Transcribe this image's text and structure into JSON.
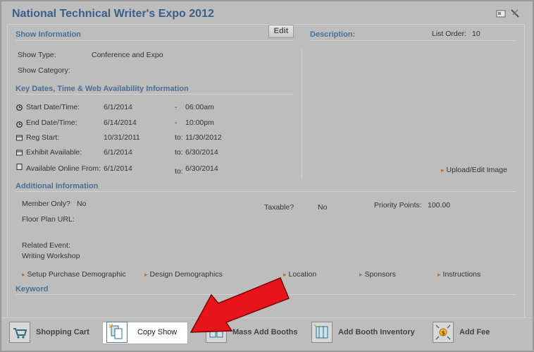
{
  "header": {
    "title": "National Technical Writer's Expo 2012"
  },
  "show_info": {
    "heading": "Show Information",
    "edit_label": "Edit",
    "show_type_label": "Show Type:",
    "show_type_value": "Conference and Expo",
    "show_category_label": "Show Category:"
  },
  "description": {
    "heading": "Description:",
    "list_order_label": "List Order:",
    "list_order_value": "10",
    "upload_link": "Upload/Edit Image"
  },
  "key_dates": {
    "heading": "Key Dates, Time & Web Availability Information",
    "rows": [
      {
        "label": "Start Date/Time:",
        "date": "6/1/2014",
        "sep": "-",
        "end": "06:00am"
      },
      {
        "label": "End Date/Time:",
        "date": "6/14/2014",
        "sep": "-",
        "end": "10:00pm"
      },
      {
        "label": "Reg Start:",
        "date": "10/31/2011",
        "sep": "to:",
        "end": "11/30/2012"
      },
      {
        "label": "Exhibit Available:",
        "date": "6/1/2014",
        "sep": "to:",
        "end": "6/30/2014"
      },
      {
        "label": "Available Online From:",
        "date": "6/1/2014",
        "sep": "to:",
        "end": "6/30/2014"
      }
    ]
  },
  "additional": {
    "heading": "Additional Information",
    "member_only_label": "Member Only?",
    "member_only_value": "No",
    "taxable_label": "Taxable?",
    "taxable_value": "No",
    "priority_label": "Priority Points:",
    "priority_value": "100.00",
    "floor_plan_label": "Floor Plan URL:",
    "related_event_label": "Related Event:",
    "related_event_value": "Writing Workshop",
    "links": [
      "Setup Purchase Demographic",
      "Design Demographics",
      "Location",
      "Sponsors",
      "Instructions"
    ]
  },
  "keyword": {
    "heading": "Keyword"
  },
  "footer": {
    "shopping_cart": "Shopping Cart",
    "copy_show": "Copy Show",
    "mass_add_booths": "Mass Add Booths",
    "add_booth_inventory": "Add Booth Inventory",
    "add_fee": "Add Fee"
  },
  "colors": {
    "accent": "#4a6f96",
    "arrow": "#e8141b",
    "background": "#bdbdbd"
  }
}
